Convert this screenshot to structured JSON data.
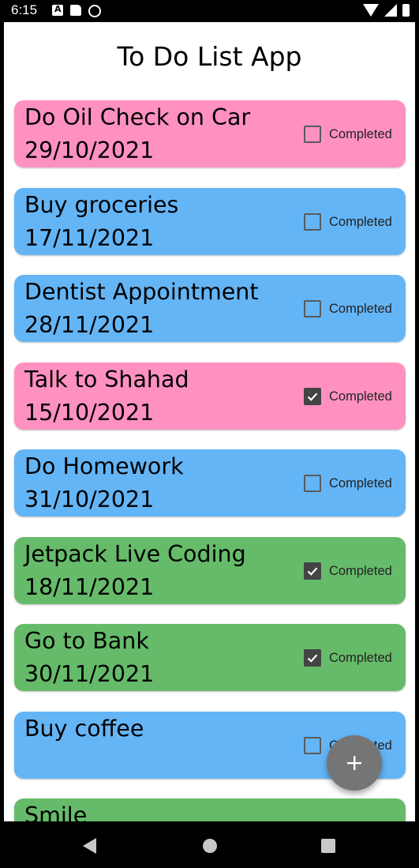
{
  "status_bar": {
    "time": "6:15",
    "left_icons": [
      "a-notification-icon",
      "sd-card-icon",
      "vpn-key-icon"
    ],
    "right_icons": [
      "wifi-icon",
      "signal-icon",
      "battery-icon"
    ]
  },
  "app": {
    "title": "To Do List App",
    "completed_label": "Completed",
    "fab_icon": "plus-icon"
  },
  "colors": {
    "pink": "#FF91C0",
    "blue": "#64B5F6",
    "green": "#66BB6A",
    "fab": "#757575"
  },
  "tasks": [
    {
      "title": "Do Oil Check on Car",
      "date": "29/10/2021",
      "completed": false,
      "color": "#FF91C0"
    },
    {
      "title": "Buy groceries",
      "date": "17/11/2021",
      "completed": false,
      "color": "#64B5F6"
    },
    {
      "title": "Dentist Appointment",
      "date": "28/11/2021",
      "completed": false,
      "color": "#64B5F6"
    },
    {
      "title": "Talk to Shahad",
      "date": "15/10/2021",
      "completed": true,
      "color": "#FF91C0"
    },
    {
      "title": "Do Homework",
      "date": "31/10/2021",
      "completed": false,
      "color": "#64B5F6"
    },
    {
      "title": "Jetpack Live Coding",
      "date": "18/11/2021",
      "completed": true,
      "color": "#66BB6A"
    },
    {
      "title": "Go to Bank",
      "date": "30/11/2021",
      "completed": true,
      "color": "#66BB6A"
    },
    {
      "title": "Buy coffee",
      "date": "",
      "completed": false,
      "color": "#64B5F6"
    },
    {
      "title": "Smile",
      "date": "",
      "completed": false,
      "color": "#66BB6A"
    }
  ],
  "nav_bar": {
    "buttons": [
      "back-icon",
      "home-icon",
      "recents-icon"
    ]
  }
}
